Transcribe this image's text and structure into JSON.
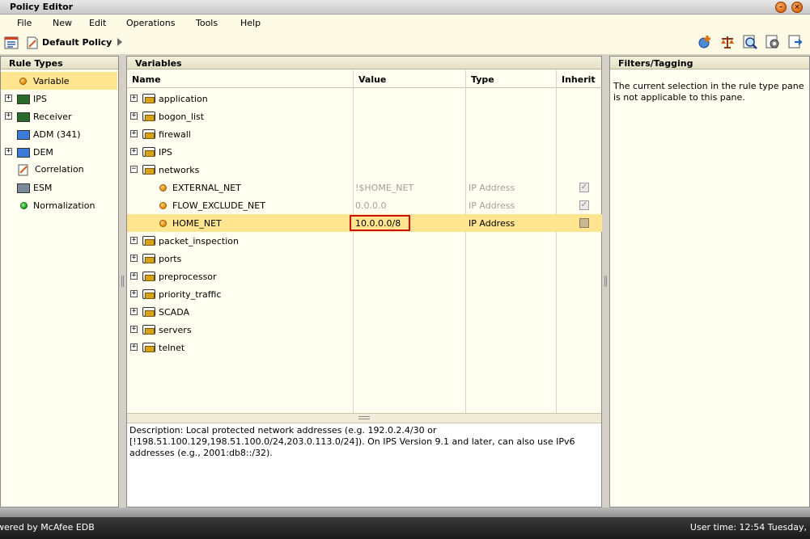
{
  "window": {
    "title": "Policy Editor"
  },
  "menu": [
    "File",
    "New",
    "Edit",
    "Operations",
    "Tools",
    "Help"
  ],
  "toolbar": {
    "policy_name": "Default Policy"
  },
  "rule_types": {
    "header": "Rule Types",
    "items": [
      {
        "label": "Variable",
        "icon": "orange-dot-icon",
        "expandable": false,
        "selected": true
      },
      {
        "label": "IPS",
        "icon": "ips-chip-icon",
        "expandable": true
      },
      {
        "label": "Receiver",
        "icon": "receiver-icon",
        "expandable": true
      },
      {
        "label": "ADM (341)",
        "icon": "adm-icon",
        "expandable": false
      },
      {
        "label": "DEM",
        "icon": "dem-icon",
        "expandable": true
      },
      {
        "label": "Correlation",
        "icon": "correlation-icon",
        "expandable": false
      },
      {
        "label": "ESM",
        "icon": "esm-icon",
        "expandable": false
      },
      {
        "label": "Normalization",
        "icon": "green-dot-icon",
        "expandable": false
      }
    ]
  },
  "variables": {
    "header": "Variables",
    "columns": [
      "Name",
      "Value",
      "Type",
      "Inherit"
    ],
    "rows": [
      {
        "name": "application",
        "kind": "folder",
        "expanded": false
      },
      {
        "name": "bogon_list",
        "kind": "folder",
        "expanded": false
      },
      {
        "name": "firewall",
        "kind": "folder",
        "expanded": false
      },
      {
        "name": "IPS",
        "kind": "folder",
        "expanded": false
      },
      {
        "name": "networks",
        "kind": "folder",
        "expanded": true
      },
      {
        "name": "EXTERNAL_NET",
        "kind": "var",
        "value": "!$HOME_NET",
        "type": "IP Address",
        "inherit": true,
        "dimmed": true
      },
      {
        "name": "FLOW_EXCLUDE_NET",
        "kind": "var",
        "value": "0.0.0.0",
        "type": "IP Address",
        "inherit": true,
        "dimmed": true
      },
      {
        "name": "HOME_NET",
        "kind": "var",
        "value": "10.0.0.0/8",
        "type": "IP Address",
        "inherit": false,
        "selected": true
      },
      {
        "name": "packet_inspection",
        "kind": "folder",
        "expanded": false
      },
      {
        "name": "ports",
        "kind": "folder",
        "expanded": false
      },
      {
        "name": "preprocessor",
        "kind": "folder",
        "expanded": false
      },
      {
        "name": "priority_traffic",
        "kind": "folder",
        "expanded": false
      },
      {
        "name": "SCADA",
        "kind": "folder",
        "expanded": false
      },
      {
        "name": "servers",
        "kind": "folder",
        "expanded": false
      },
      {
        "name": "telnet",
        "kind": "folder",
        "expanded": false
      }
    ],
    "description": "Description: Local protected network addresses (e.g. 192.0.2.4/30 or [!198.51.100.129,198.51.100.0/24,203.0.113.0/24]). On IPS Version 9.1 and later, can also use IPv6 addresses (e.g., 2001:db8::/32)."
  },
  "filters": {
    "header": "Filters/Tagging",
    "message": "The current selection in the rule type pane is not applicable to this pane."
  },
  "status": {
    "left": "wered by McAfee EDB",
    "right": "User time:  12:54 Tuesday,"
  },
  "colors": {
    "selection": "#ffe58f",
    "highlight_border": "#d01010",
    "panel_bg": "#fffef0"
  }
}
